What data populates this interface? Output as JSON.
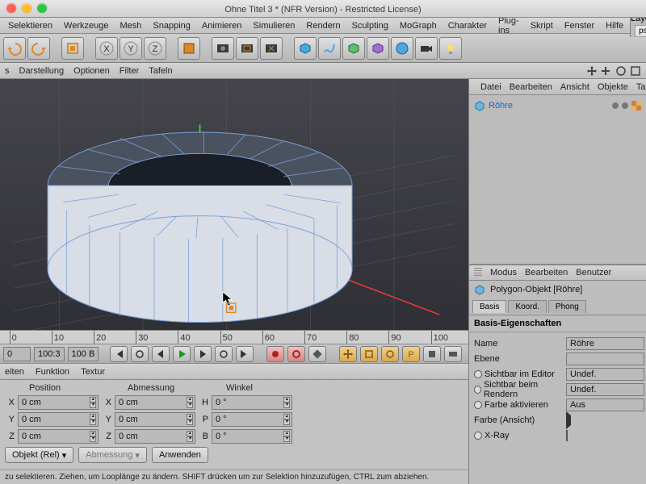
{
  "title": "Ohne Titel 3 * (NFR Version) - Restricted License)",
  "menu": [
    "Selektieren",
    "Werkzeuge",
    "Mesh",
    "Snapping",
    "Animieren",
    "Simulieren",
    "Rendern",
    "Sculpting",
    "MoGraph",
    "Charakter",
    "Plug-ins",
    "Skript",
    "Fenster",
    "Hilfe"
  ],
  "layout_label": "Layout:",
  "layout_value": "psd",
  "secbar": [
    "s",
    "Darstellung",
    "Optionen",
    "Filter",
    "Tafeln"
  ],
  "ruler_ticks": [
    "0",
    "10",
    "20",
    "30",
    "40",
    "50",
    "60",
    "70",
    "80",
    "90",
    "100"
  ],
  "timeline": {
    "start": "0",
    "ratio": "100:3",
    "frames": "100 B"
  },
  "coord_tabs": [
    "eiten",
    "Funktion",
    "Textur"
  ],
  "coord_headers": [
    "Position",
    "Abmessung",
    "Winkel"
  ],
  "coords": {
    "rows": [
      {
        "axis": "X",
        "pos": "0 cm",
        "size": "0 cm",
        "ang_lbl": "H",
        "ang": "0 °"
      },
      {
        "axis": "Y",
        "pos": "0 cm",
        "size": "0 cm",
        "ang_lbl": "P",
        "ang": "0 °"
      },
      {
        "axis": "Z",
        "pos": "0 cm",
        "size": "0 cm",
        "ang_lbl": "B",
        "ang": "0 °"
      }
    ],
    "mode": "Objekt (Rel)",
    "size_btn": "Abmessung",
    "apply": "Anwenden"
  },
  "status": "zu selektieren. Ziehen, um Looplänge zu ändern. SHIFT drücken um zur Selektion hinzuzufügen, CTRL zum abziehen.",
  "right": {
    "topmenu": [
      "Datei",
      "Bearbeiten",
      "Ansicht",
      "Objekte",
      "Tag"
    ],
    "object_name": "Röhre",
    "attr_tabs": [
      "Modus",
      "Bearbeiten",
      "Benutzer"
    ],
    "obj_header": "Polygon-Objekt [Röhre]",
    "tabs2": [
      "Basis",
      "Koord.",
      "Phong"
    ],
    "section": "Basis-Eigenschaften",
    "props": [
      {
        "label": "Name",
        "value": "Röhre",
        "type": "text"
      },
      {
        "label": "Ebene",
        "value": "",
        "type": "text"
      },
      {
        "label": "Sichtbar im Editor",
        "value": "Undef.",
        "type": "drop",
        "radio": true
      },
      {
        "label": "Sichtbar beim Rendern",
        "value": "Undef.",
        "type": "drop",
        "radio": true
      },
      {
        "label": "Farbe aktivieren",
        "value": "Aus",
        "type": "drop",
        "radio": true
      },
      {
        "label": "Farbe (Ansicht)",
        "value": "",
        "type": "expand"
      },
      {
        "label": "X-Ray",
        "value": "",
        "type": "check",
        "radio": true
      }
    ]
  }
}
